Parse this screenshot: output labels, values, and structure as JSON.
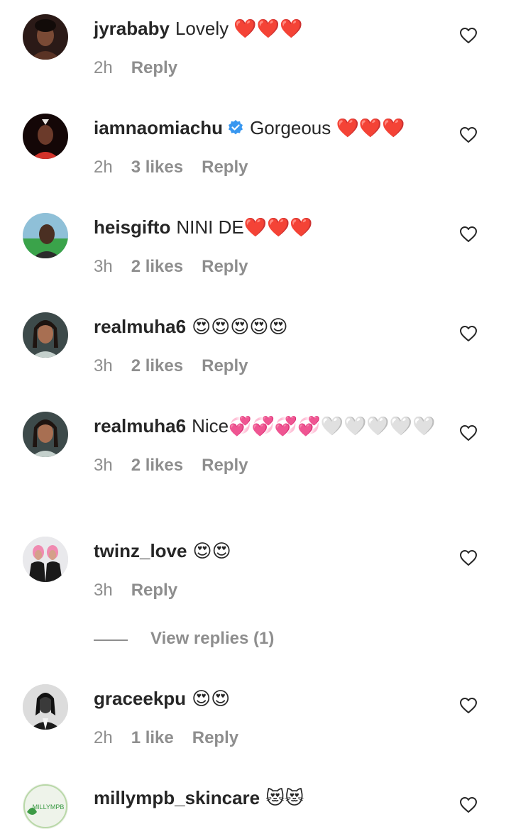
{
  "comments": [
    {
      "username": "jyrababy",
      "text": "Lovely ❤️❤️❤️",
      "time": "2h",
      "likes": "",
      "reply": "Reply",
      "verified": false
    },
    {
      "username": "iamnaomiachu",
      "text": "Gorgeous ❤️❤️❤️",
      "time": "2h",
      "likes": "3 likes",
      "reply": "Reply",
      "verified": true
    },
    {
      "username": "heisgifto",
      "text": "NINI DE❤️❤️❤️",
      "time": "3h",
      "likes": "2 likes",
      "reply": "Reply",
      "verified": false
    },
    {
      "username": "realmuha6",
      "text": "😍😍😍😍😍",
      "time": "3h",
      "likes": "2 likes",
      "reply": "Reply",
      "verified": false
    },
    {
      "username": "realmuha6",
      "text": "Nice💞💞💞💞🤍🤍🤍🤍🤍",
      "time": "3h",
      "likes": "2 likes",
      "reply": "Reply",
      "verified": false
    },
    {
      "username": "twinz_love",
      "text": "😍😍",
      "time": "3h",
      "likes": "",
      "reply": "Reply",
      "verified": false
    },
    {
      "username": "graceekpu",
      "text": "😍😍",
      "time": "2h",
      "likes": "1 like",
      "reply": "Reply",
      "verified": false
    },
    {
      "username": "millympb_skincare",
      "text": "😻😻",
      "time": "",
      "likes": "",
      "reply": "",
      "verified": false
    }
  ],
  "view_replies": "View replies (1)",
  "avatar_logo_text": "MILLYMPB",
  "icons": {
    "like": "heart-outline-icon",
    "verified": "verified-badge-icon"
  },
  "colors": {
    "text": "#262626",
    "secondary": "#8e8e8e",
    "verified": "#3897f0"
  }
}
